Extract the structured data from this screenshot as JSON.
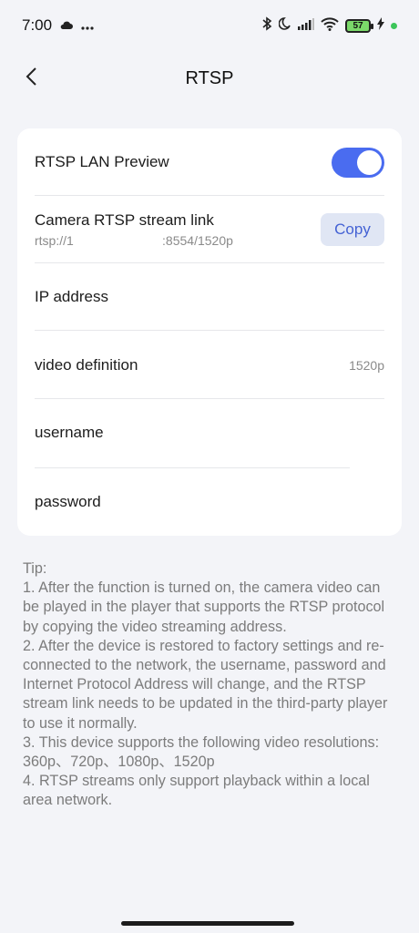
{
  "status_bar": {
    "time": "7:00",
    "battery": "57"
  },
  "header": {
    "title": "RTSP"
  },
  "settings": {
    "lan_preview_label": "RTSP LAN Preview",
    "lan_preview_on": true,
    "stream_link_label": "Camera RTSP stream link",
    "stream_link_value": "rtsp://1                         :8554/1520p",
    "copy_label": "Copy",
    "ip_label": "IP address",
    "video_definition_label": "video definition",
    "video_definition_value": "1520p",
    "username_label": "username",
    "password_label": "password"
  },
  "tip": {
    "title": "Tip:",
    "items": [
      "1. After the function is turned on, the camera video can be played in the player that supports the RTSP protocol by copying the video streaming address.",
      "2. After the device is restored to factory settings and re-connected to the network, the username, password and Internet Protocol Address will change, and the RTSP stream link needs to be updated in the third-party player to use it normally.",
      "3. This device supports the following video resolutions: 360p、720p、1080p、1520p",
      "4. RTSP streams only support playback within a local area network."
    ]
  },
  "colors": {
    "accent": "#4a6cf0",
    "background": "#f3f4f8",
    "copy_bg": "#e0e6f4"
  }
}
